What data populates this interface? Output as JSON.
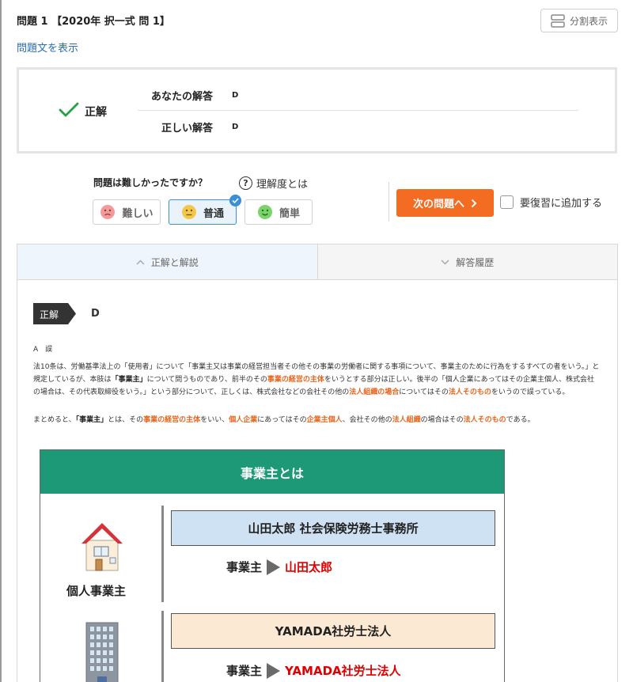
{
  "header": {
    "question_title": "問題 1 【2020年 択一式 問 1】",
    "split_view_label": "分割表示",
    "show_question_link": "問題文を表示"
  },
  "result": {
    "status_label": "正解",
    "your_answer_label": "あなたの解答",
    "your_answer_value": "D",
    "correct_answer_label": "正しい解答",
    "correct_answer_value": "D"
  },
  "difficulty": {
    "question": "問題は難しかったですか？",
    "help_label": "理解度とは",
    "options": [
      {
        "label": "難しい",
        "selected": false
      },
      {
        "label": "普通",
        "selected": true
      },
      {
        "label": "簡単",
        "selected": false
      }
    ],
    "next_button": "次の問題へ",
    "review_label": "要復習に追加する"
  },
  "tabs": [
    {
      "label": "正解と解説",
      "active": true
    },
    {
      "label": "解答履歴",
      "active": false
    }
  ],
  "answer": {
    "tag": "正解",
    "letter": "D"
  },
  "explanation": {
    "heading": "A　誤",
    "p1_segments": [
      {
        "t": "法10条は、労働基準法上の「使用者」について「事業主又は事業の経営担当者その他その事業の労働者に関する事項について、事業主のために行為をするすべての者をいう。」と規定しているが、本肢は",
        "s": "n"
      },
      {
        "t": "「事業主」",
        "s": "b"
      },
      {
        "t": "について問うものであり、前半のその",
        "s": "n"
      },
      {
        "t": "事業の経営の主体",
        "s": "h"
      },
      {
        "t": "をいうとする部分は正しい。後半の「個人企業にあってはその企業主個人、株式会社の場合は、その代表取締役をいう。」という部分について、正しくは、株式会社などの会社その他の",
        "s": "n"
      },
      {
        "t": "法人組織の場合",
        "s": "h"
      },
      {
        "t": "についてはその",
        "s": "n"
      },
      {
        "t": "法人そのもの",
        "s": "h"
      },
      {
        "t": "をいうので誤っている。",
        "s": "n"
      }
    ],
    "p2_segments": [
      {
        "t": "まとめると、",
        "s": "n"
      },
      {
        "t": "「事業主」",
        "s": "b"
      },
      {
        "t": "とは、その",
        "s": "n"
      },
      {
        "t": "事業の経営の主体",
        "s": "h"
      },
      {
        "t": "をいい、",
        "s": "n"
      },
      {
        "t": "個人企業",
        "s": "h"
      },
      {
        "t": "にあってはその",
        "s": "n"
      },
      {
        "t": "企業主個人",
        "s": "h"
      },
      {
        "t": "、会社その他の",
        "s": "n"
      },
      {
        "t": "法人組織",
        "s": "h"
      },
      {
        "t": "の場合はその",
        "s": "n"
      },
      {
        "t": "法人そのもの",
        "s": "h"
      },
      {
        "t": "である。",
        "s": "n"
      }
    ]
  },
  "diagram": {
    "title": "事業主とは",
    "rows": [
      {
        "label": "個人事業主",
        "box": "山田太郎 社会保険労務士事務所",
        "employer_label": "事業主",
        "employer_value": "山田太郎"
      },
      {
        "label": "",
        "box": "YAMADA社労士法人",
        "employer_label": "事業主",
        "employer_value": "YAMADA社労士法人"
      }
    ]
  },
  "colors": {
    "accent_orange": "#f36c21",
    "link_blue": "#2b6cb0",
    "highlight_orange": "#e8641b",
    "diagram_green": "#1e9978",
    "check_green": "#27a243",
    "emphasis_red": "#e10000"
  }
}
